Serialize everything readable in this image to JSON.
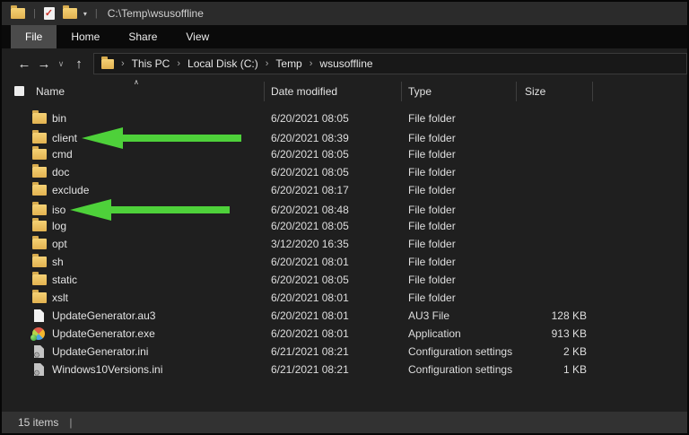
{
  "titlebar": {
    "path": "C:\\Temp\\wsusoffline",
    "separator": "|",
    "qat_dropdown_icon": "▾"
  },
  "menu": {
    "tabs": [
      {
        "label": "File",
        "active": true
      },
      {
        "label": "Home",
        "active": false
      },
      {
        "label": "Share",
        "active": false
      },
      {
        "label": "View",
        "active": false
      }
    ]
  },
  "nav": {
    "back_icon": "←",
    "forward_icon": "→",
    "recent_icon": "∨",
    "up_icon": "↑",
    "breadcrumb_separator": "›",
    "breadcrumbs": [
      "This PC",
      "Local Disk (C:)",
      "Temp",
      "wsusoffline"
    ]
  },
  "columns": {
    "name": "Name",
    "date_modified": "Date modified",
    "type": "Type",
    "size": "Size",
    "sort_indicator": "∧"
  },
  "files": [
    {
      "name": "bin",
      "date_modified": "6/20/2021 08:05",
      "type": "File folder",
      "size": "",
      "icon": "folder",
      "arrow": false
    },
    {
      "name": "client",
      "date_modified": "6/20/2021 08:39",
      "type": "File folder",
      "size": "",
      "icon": "folder",
      "arrow": true
    },
    {
      "name": "cmd",
      "date_modified": "6/20/2021 08:05",
      "type": "File folder",
      "size": "",
      "icon": "folder",
      "arrow": false
    },
    {
      "name": "doc",
      "date_modified": "6/20/2021 08:05",
      "type": "File folder",
      "size": "",
      "icon": "folder",
      "arrow": false
    },
    {
      "name": "exclude",
      "date_modified": "6/20/2021 08:17",
      "type": "File folder",
      "size": "",
      "icon": "folder",
      "arrow": false
    },
    {
      "name": "iso",
      "date_modified": "6/20/2021 08:48",
      "type": "File folder",
      "size": "",
      "icon": "folder",
      "arrow": true
    },
    {
      "name": "log",
      "date_modified": "6/20/2021 08:05",
      "type": "File folder",
      "size": "",
      "icon": "folder",
      "arrow": false
    },
    {
      "name": "opt",
      "date_modified": "3/12/2020 16:35",
      "type": "File folder",
      "size": "",
      "icon": "folder",
      "arrow": false
    },
    {
      "name": "sh",
      "date_modified": "6/20/2021 08:01",
      "type": "File folder",
      "size": "",
      "icon": "folder",
      "arrow": false
    },
    {
      "name": "static",
      "date_modified": "6/20/2021 08:05",
      "type": "File folder",
      "size": "",
      "icon": "folder",
      "arrow": false
    },
    {
      "name": "xslt",
      "date_modified": "6/20/2021 08:01",
      "type": "File folder",
      "size": "",
      "icon": "folder",
      "arrow": false
    },
    {
      "name": "UpdateGenerator.au3",
      "date_modified": "6/20/2021 08:01",
      "type": "AU3 File",
      "size": "128 KB",
      "icon": "doc",
      "arrow": false
    },
    {
      "name": "UpdateGenerator.exe",
      "date_modified": "6/20/2021 08:01",
      "type": "Application",
      "size": "913 KB",
      "icon": "exe",
      "arrow": false
    },
    {
      "name": "UpdateGenerator.ini",
      "date_modified": "6/21/2021 08:21",
      "type": "Configuration settings",
      "size": "2 KB",
      "icon": "ini",
      "arrow": false
    },
    {
      "name": "Windows10Versions.ini",
      "date_modified": "6/21/2021 08:21",
      "type": "Configuration settings",
      "size": "1 KB",
      "icon": "ini",
      "arrow": false
    }
  ],
  "statusbar": {
    "item_count": "15 items",
    "divider": "|"
  },
  "colors": {
    "arrow_green": "#4ed13a",
    "folder_yellow": "#f5d175",
    "window_bg": "#1f1f1f",
    "titlebar_bg": "#2b2b2b",
    "statusbar_bg": "#323232"
  }
}
